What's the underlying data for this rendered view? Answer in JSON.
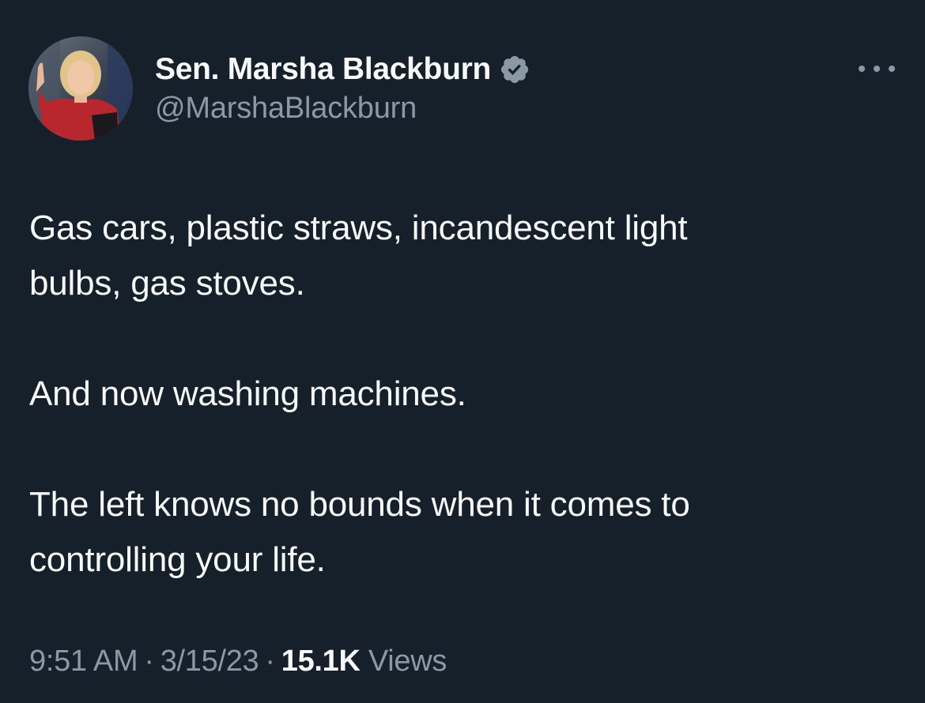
{
  "author": {
    "display_name": "Sen. Marsha Blackburn",
    "handle": "@MarshaBlackburn",
    "verified_icon": "verified-badge-icon",
    "verified_color": "#8b98a5"
  },
  "tweet": {
    "paragraphs": [
      [
        "Gas cars, plastic straws, incandescent light",
        "bulbs, gas stoves."
      ],
      [
        "And now washing machines."
      ],
      [
        "The left knows no bounds when it comes to",
        "controlling your life."
      ]
    ]
  },
  "meta": {
    "time": "9:51 AM",
    "separator": "·",
    "date": "3/15/23",
    "views_count": "15.1K",
    "views_label": "Views"
  },
  "more_menu": {
    "icon": "more-horizontal-icon"
  },
  "colors": {
    "background": "#15202b",
    "text_primary": "#f7f9f9",
    "text_secondary": "#8b98a5"
  }
}
